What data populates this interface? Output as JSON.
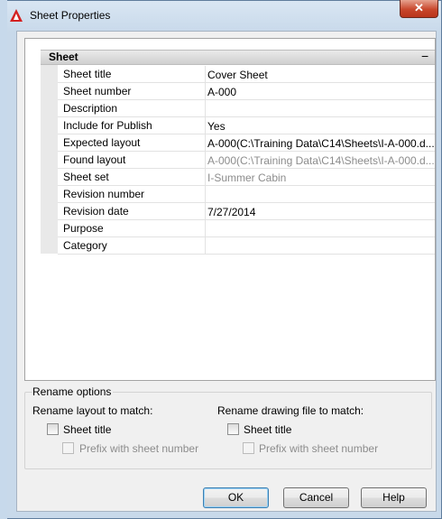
{
  "window": {
    "title": "Sheet Properties",
    "close_glyph": "✕"
  },
  "grid": {
    "category": "Sheet",
    "collapse_glyph": "−",
    "rows": [
      {
        "name": "Sheet title",
        "value": "Cover Sheet",
        "dim": false
      },
      {
        "name": "Sheet number",
        "value": "A-000",
        "dim": false
      },
      {
        "name": "Description",
        "value": "",
        "dim": false
      },
      {
        "name": "Include for Publish",
        "value": "Yes",
        "dim": false
      },
      {
        "name": "Expected layout",
        "value": "A-000(C:\\Training Data\\C14\\Sheets\\I-A-000.d...",
        "dim": false
      },
      {
        "name": "Found layout",
        "value": "A-000(C:\\Training Data\\C14\\Sheets\\I-A-000.d...",
        "dim": true
      },
      {
        "name": "Sheet set",
        "value": "I-Summer Cabin",
        "dim": true
      },
      {
        "name": "Revision number",
        "value": "",
        "dim": false
      },
      {
        "name": "Revision date",
        "value": "7/27/2014",
        "dim": false
      },
      {
        "name": "Purpose",
        "value": "",
        "dim": false
      },
      {
        "name": "Category",
        "value": "",
        "dim": false
      }
    ]
  },
  "rename": {
    "group_label": "Rename options",
    "layout_heading": "Rename layout to match:",
    "layout_sheet_title": "Sheet title",
    "layout_prefix": "Prefix with sheet number",
    "drawing_heading": "Rename drawing file to match:",
    "drawing_sheet_title": "Sheet title",
    "drawing_prefix": "Prefix with sheet number"
  },
  "buttons": {
    "ok": "OK",
    "cancel": "Cancel",
    "help": "Help"
  }
}
